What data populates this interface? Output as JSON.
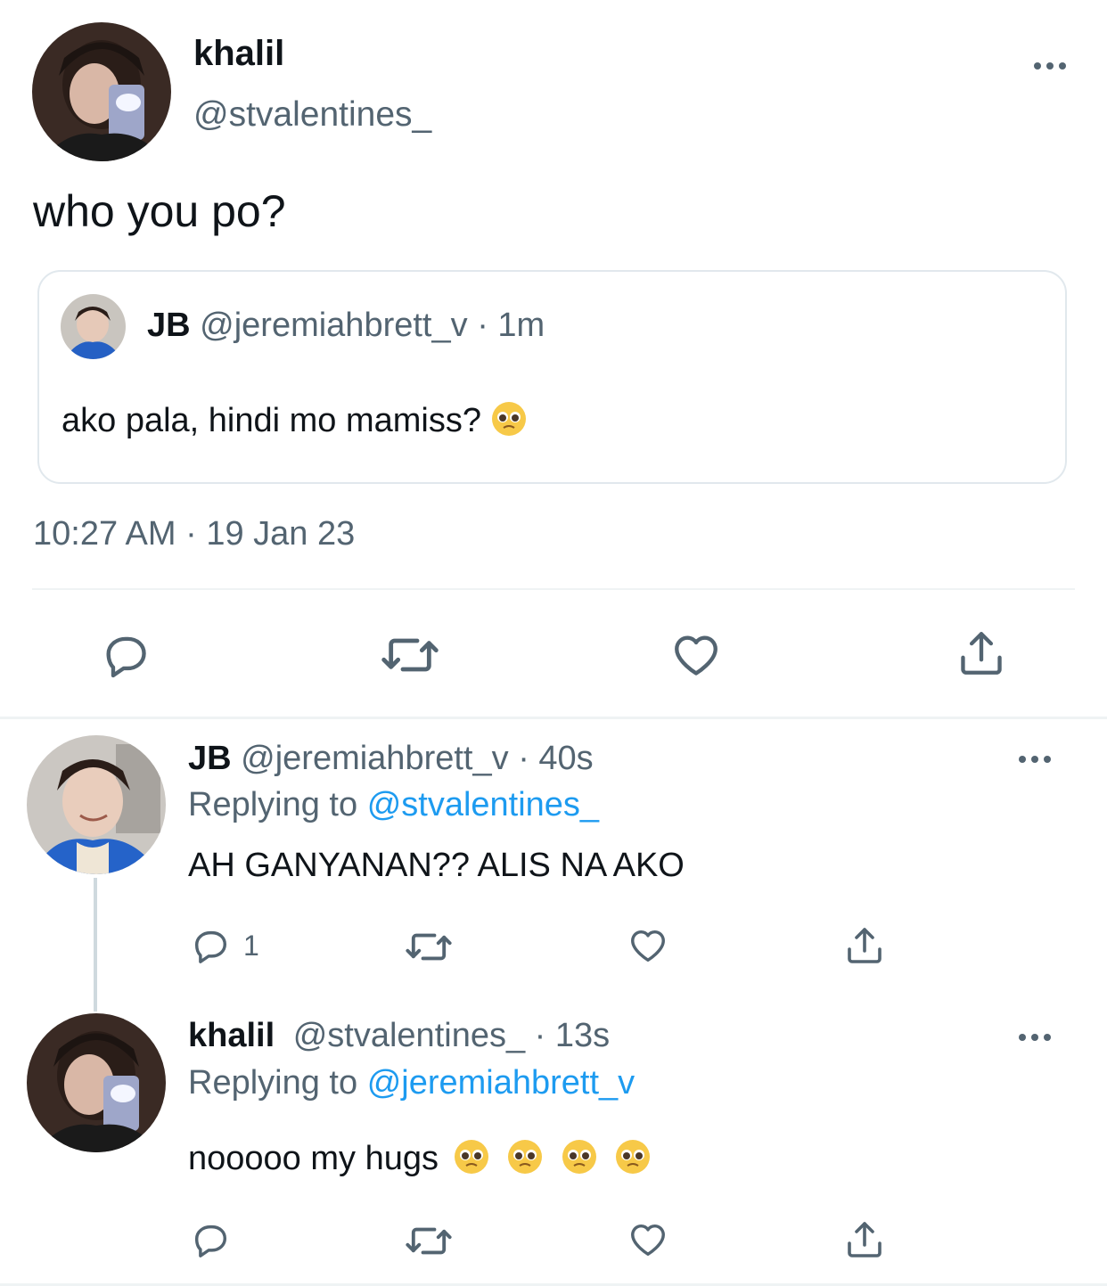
{
  "main_tweet": {
    "author_name": "khalil",
    "author_handle": "@stvalentines_",
    "text": "who you po?",
    "timestamp": "10:27 AM · 19 Jan 23",
    "avatar_icon": "avatar-photo-icon"
  },
  "quoted_tweet": {
    "author_name": "JB",
    "author_handle": "@jeremiahbrett_v",
    "time": "· 1m",
    "text": "ako pala, hindi mo mamiss?",
    "emoji": "pleading-face"
  },
  "replies": [
    {
      "author_name": "JB",
      "author_handle": "@jeremiahbrett_v",
      "time": "· 40s",
      "replying_prefix": "Replying to",
      "replying_handle": "@stvalentines_",
      "text": "AH GANYANAN?? ALIS NA AKO",
      "reply_count": "1"
    },
    {
      "author_name": "khalil",
      "author_handle": "@stvalentines_",
      "time": "· 13s",
      "replying_prefix": "Replying to",
      "replying_handle": "@jeremiahbrett_v",
      "text": "nooooo my hugs",
      "emoji_count": 4
    }
  ],
  "colors": {
    "text": "#0f1419",
    "muted": "#536471",
    "link": "#1d9bf0",
    "divider": "#eff3f4"
  }
}
